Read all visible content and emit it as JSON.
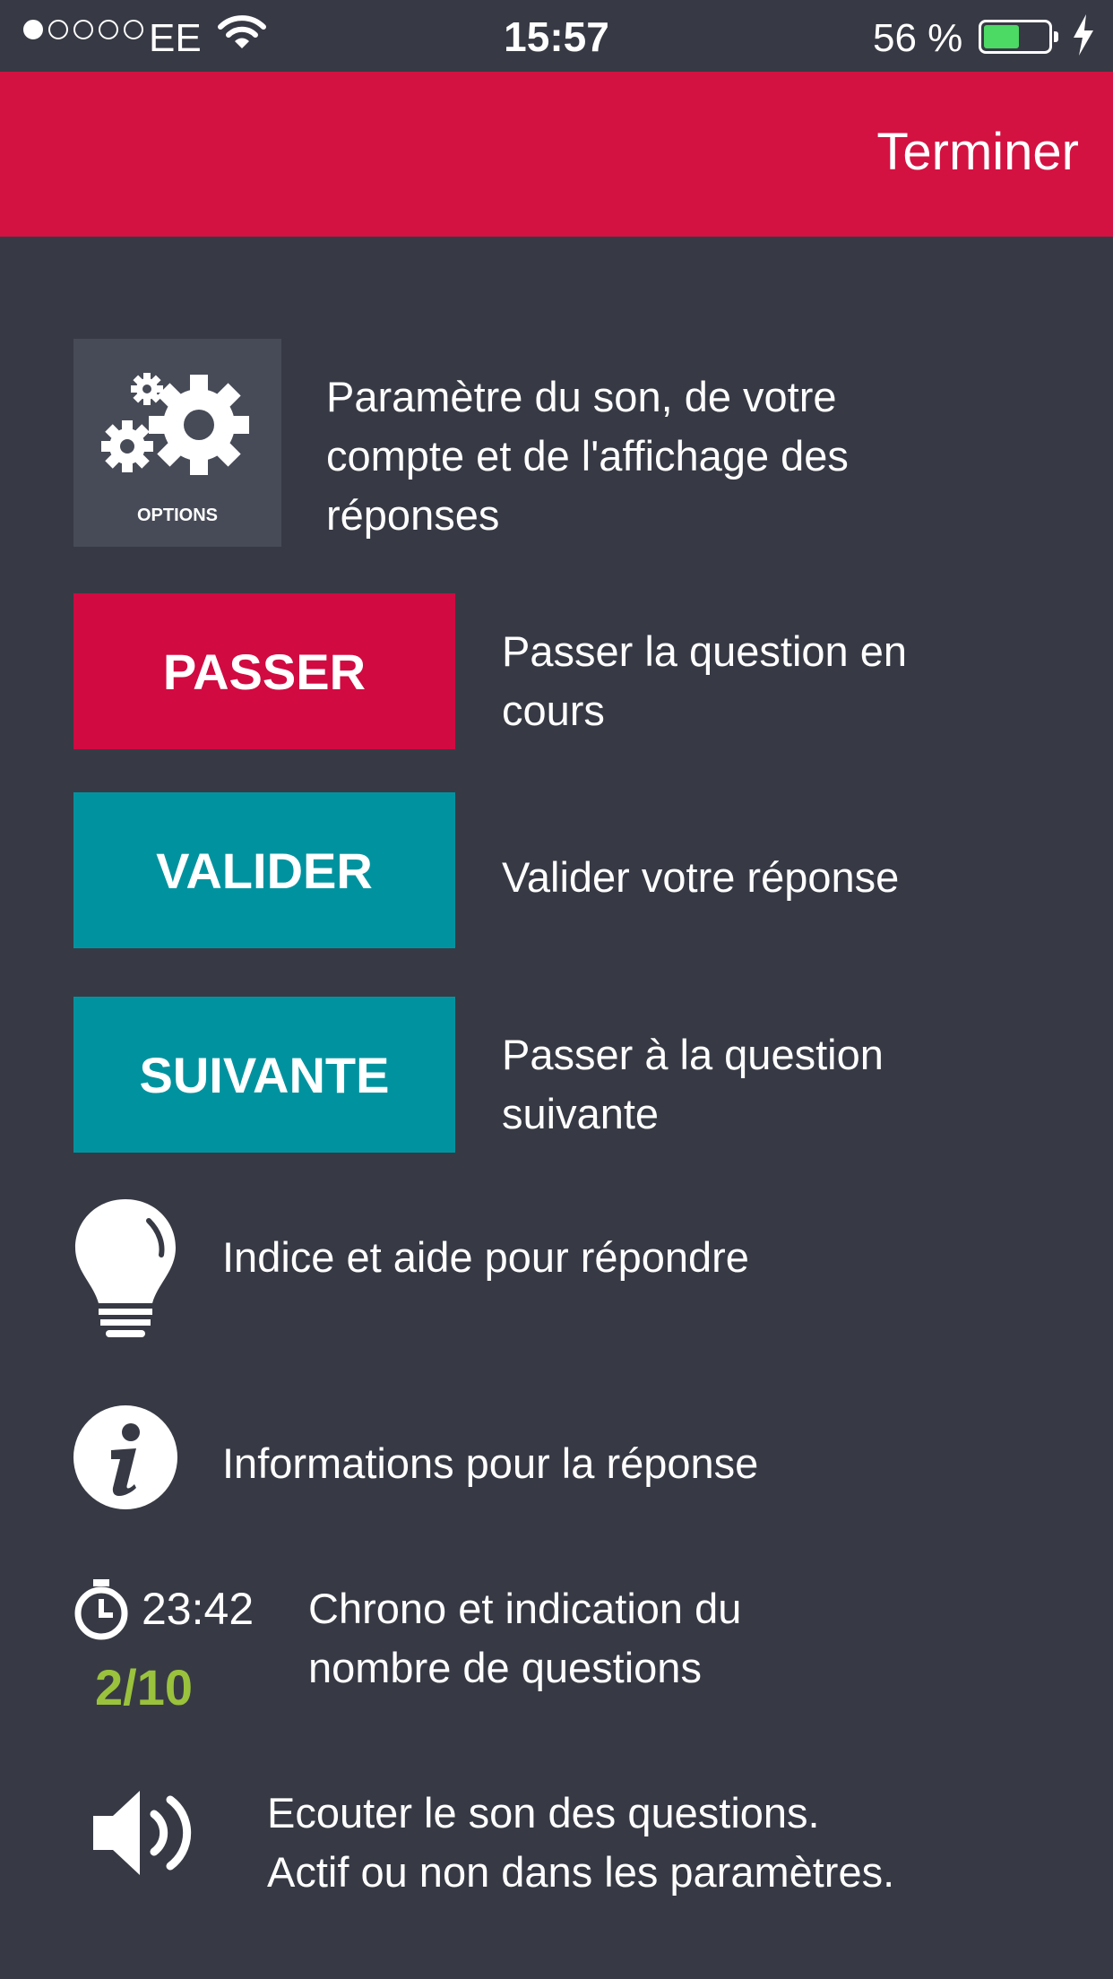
{
  "status_bar": {
    "carrier": "EE",
    "time": "15:57",
    "battery_percent": "56 %",
    "battery_level": 0.56,
    "signal_strength": 1,
    "signal_max": 5,
    "icons": [
      "wifi-icon",
      "charging-bolt-icon"
    ]
  },
  "header": {
    "finish_label": "Terminer",
    "color": "#d31242"
  },
  "legend": {
    "options": {
      "tile_label": "OPTIONS",
      "description_lines": [
        "Paramètre du son, de votre",
        "compte et de l'affichage des",
        "réponses"
      ]
    },
    "skip": {
      "button_label": "PASSER",
      "description_lines": [
        "Passer la question en",
        "cours"
      ],
      "color": "#d10a42"
    },
    "validate": {
      "button_label": "VALIDER",
      "description_lines": [
        "Valider votre réponse"
      ],
      "color": "#00939f"
    },
    "next": {
      "button_label": "SUIVANTE",
      "description_lines": [
        "Passer à la question",
        "suivante"
      ],
      "color": "#00939f"
    },
    "hint": {
      "icon": "lightbulb-icon",
      "description": "Indice et aide pour répondre"
    },
    "info": {
      "icon": "info-icon",
      "description": "Informations pour la réponse"
    },
    "timer": {
      "icon": "stopwatch-icon",
      "time": "23:42",
      "count": "2/10",
      "count_color": "#9ac23c",
      "description_lines": [
        "Chrono et indication du",
        "nombre de questions"
      ]
    },
    "sound": {
      "icon": "speaker-icon",
      "description_lines": [
        "Ecouter le son des questions.",
        "Actif ou non dans les paramètres."
      ]
    }
  },
  "background_color": "#373a44"
}
